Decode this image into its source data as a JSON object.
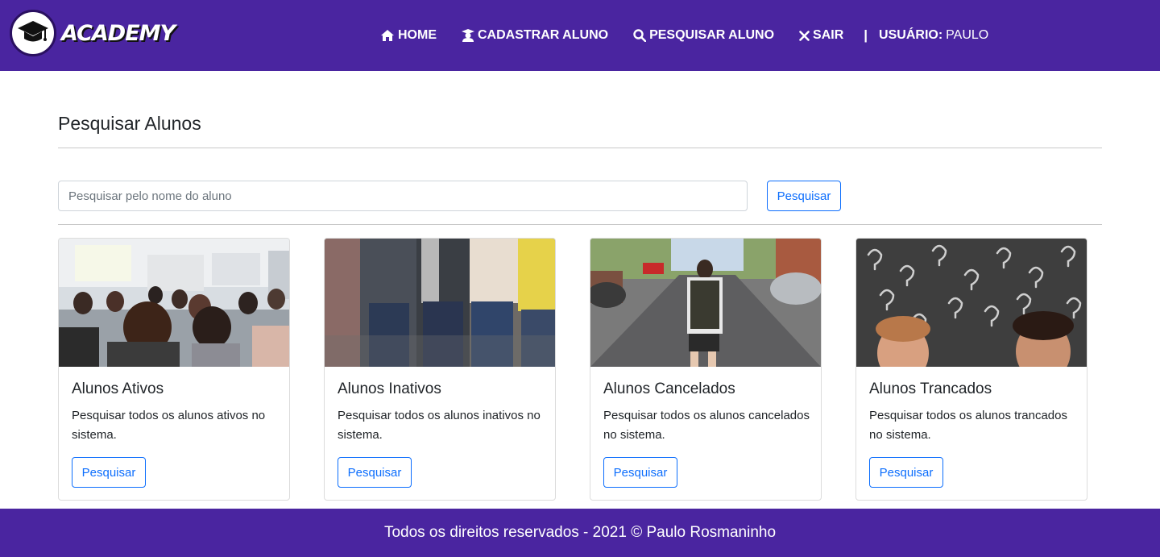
{
  "brand": {
    "name": "ACADEMY",
    "logo_icon": "graduation-cap-icon"
  },
  "nav": {
    "items": [
      {
        "label": "HOME",
        "icon": "home-icon"
      },
      {
        "label": "CADASTRAR ALUNO",
        "icon": "user-graduate-icon"
      },
      {
        "label": "PESQUISAR ALUNO",
        "icon": "search-icon"
      },
      {
        "label": "SAIR",
        "icon": "close-icon"
      }
    ],
    "separator": "|",
    "user_label": "USUÁRIO:",
    "user_name": "PAULO"
  },
  "main": {
    "title": "Pesquisar Alunos",
    "search": {
      "placeholder": "Pesquisar pelo nome do aluno",
      "value": "",
      "button_label": "Pesquisar"
    }
  },
  "cards": [
    {
      "title": "Alunos Ativos",
      "text": "Pesquisar todos os alunos ativos no sistema.",
      "button_label": "Pesquisar",
      "image": "classroom-photo"
    },
    {
      "title": "Alunos Inativos",
      "text": "Pesquisar todos os alunos inativos no sistema.",
      "button_label": "Pesquisar",
      "image": "people-standing-photo"
    },
    {
      "title": "Alunos Cancelados",
      "text": "Pesquisar todos os alunos cancelados no sistema.",
      "button_label": "Pesquisar",
      "image": "student-walking-street-photo"
    },
    {
      "title": "Alunos Trancados",
      "text": "Pesquisar todos os alunos trancados no sistema.",
      "button_label": "Pesquisar",
      "image": "question-marks-photo"
    }
  ],
  "footer": {
    "text": "Todos os direitos reservados - 2021 © Paulo Rosmaninho"
  },
  "colors": {
    "primary": "#4a25a0",
    "accent": "#0d6efd",
    "text": "#212529"
  }
}
